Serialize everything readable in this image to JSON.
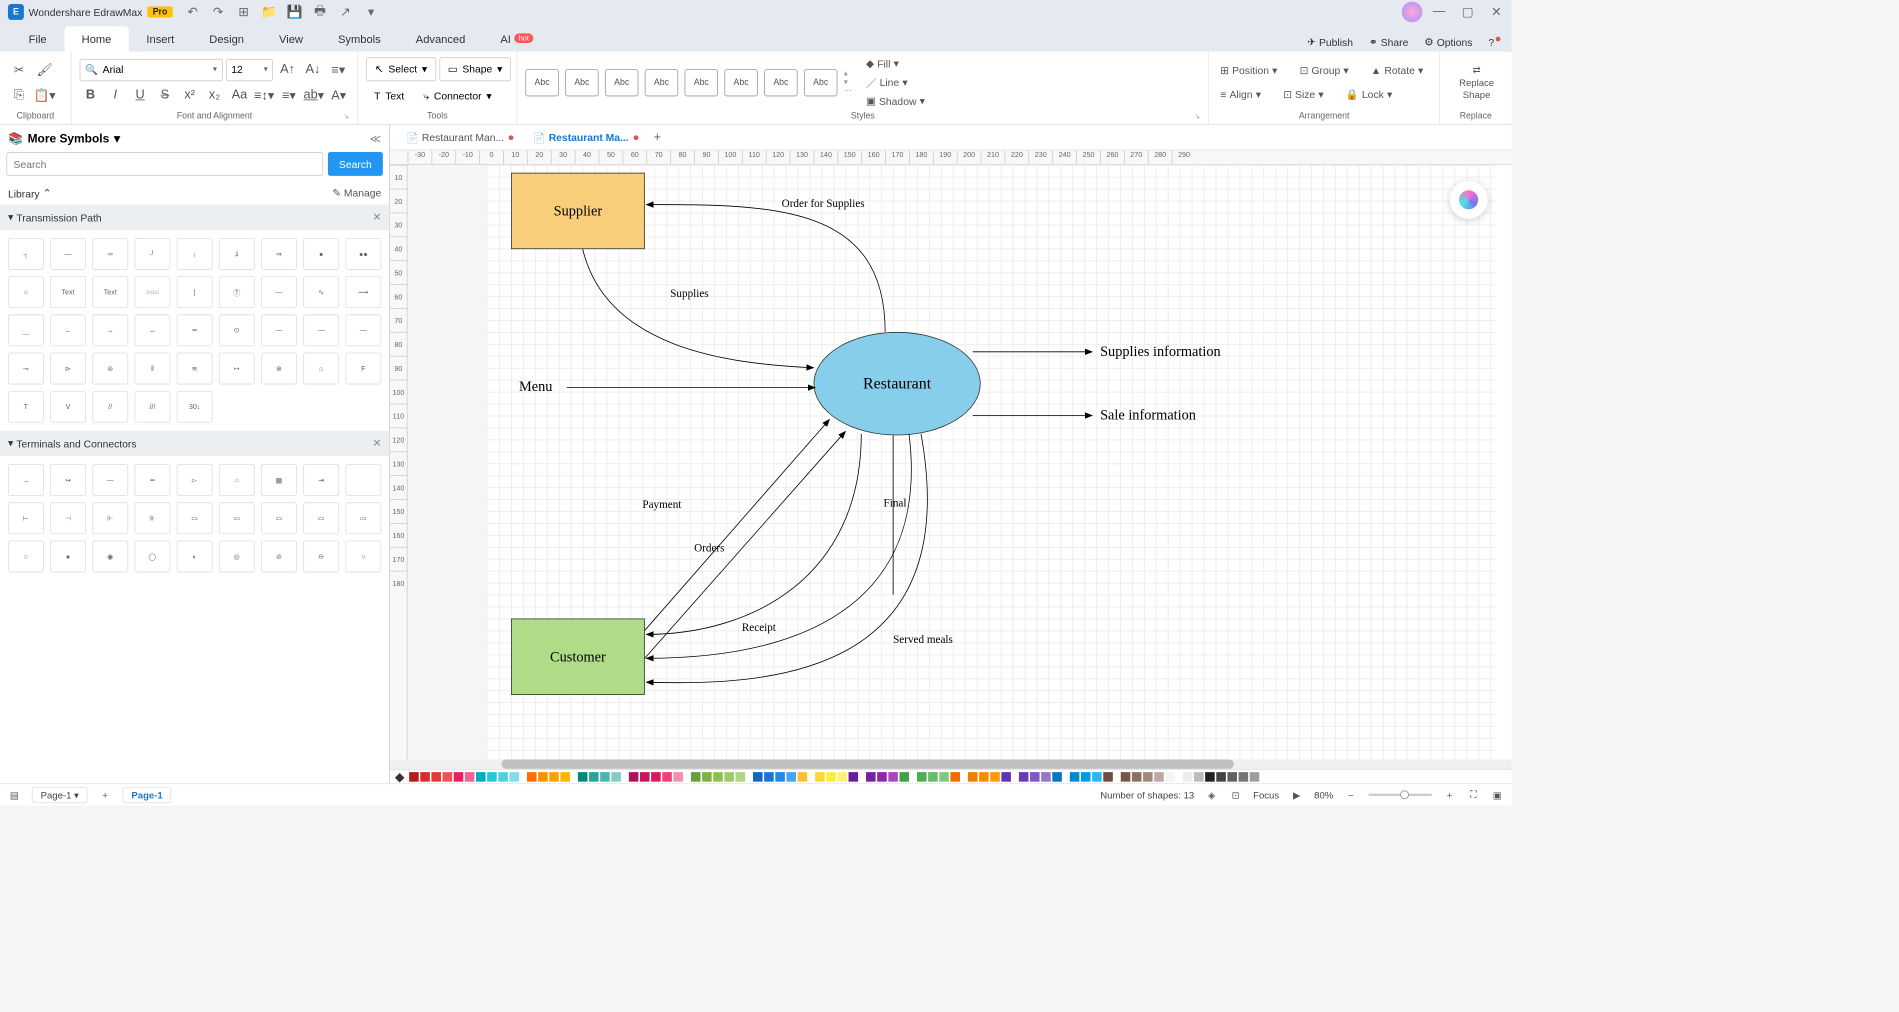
{
  "app": {
    "name": "Wondershare EdrawMax",
    "badge": "Pro"
  },
  "menu": {
    "items": [
      "File",
      "Home",
      "Insert",
      "Design",
      "View",
      "Symbols",
      "Advanced",
      "AI"
    ],
    "ai_hot": "hot",
    "active": "Home"
  },
  "topright": {
    "publish": "Publish",
    "share": "Share",
    "options": "Options"
  },
  "ribbon": {
    "clipboard": "Clipboard",
    "font_align": "Font and Alignment",
    "tools": "Tools",
    "styles": "Styles",
    "arrangement": "Arrangement",
    "replace": "Replace",
    "font": "Arial",
    "size": "12",
    "select": "Select",
    "shape": "Shape",
    "text": "Text",
    "connector": "Connector",
    "fill": "Fill",
    "line": "Line",
    "shadow": "Shadow",
    "position": "Position",
    "align": "Align",
    "group_": "Group",
    "size_": "Size",
    "rotate": "Rotate",
    "lock": "Lock",
    "replace_shape": "Replace\nShape",
    "abc": "Abc"
  },
  "sidepanel": {
    "title": "More Symbols",
    "search_placeholder": "Search",
    "search_btn": "Search",
    "library": "Library",
    "manage": "Manage",
    "cat1": "Transmission Path",
    "cat2": "Terminals and Connectors"
  },
  "doctabs": {
    "t1": "Restaurant Man...",
    "t2": "Restaurant Ma..."
  },
  "diagram": {
    "supplier": "Supplier",
    "customer": "Customer",
    "restaurant": "Restaurant",
    "menu": "Menu",
    "supplies_info": "Supplies information",
    "sale_info": "Sale information",
    "order_supplies": "Order for Supplies",
    "supplies": "Supplies",
    "payment": "Payment",
    "orders": "Orders",
    "final": "Final",
    "receipt": "Receipt",
    "served_meals": "Served meals"
  },
  "ruler_h": [
    "-30",
    "-20",
    "-10",
    "0",
    "10",
    "20",
    "30",
    "40",
    "50",
    "60",
    "70",
    "80",
    "90",
    "100",
    "110",
    "120",
    "130",
    "140",
    "150",
    "160",
    "170",
    "180",
    "190",
    "200",
    "210",
    "220",
    "230",
    "240",
    "250",
    "260",
    "270",
    "280",
    "290"
  ],
  "ruler_v": [
    "10",
    "20",
    "30",
    "40",
    "50",
    "60",
    "70",
    "80",
    "90",
    "100",
    "110",
    "120",
    "130",
    "140",
    "150",
    "160",
    "170",
    "180"
  ],
  "colors": [
    "#b71c1c",
    "#d32f2f",
    "#e53935",
    "#ef5350",
    "#e91e63",
    "#f06292",
    "#00acc1",
    "#26c6da",
    "#4dd0e1",
    "#80deea",
    "#ff6f00",
    "#ff8f00",
    "#ffa000",
    "#ffb300",
    "#00897b",
    "#26a69a",
    "#4db6ac",
    "#80cbc4",
    "#ad1457",
    "#c2185b",
    "#d81b60",
    "#ec407a",
    "#f48fb1",
    "#689f38",
    "#7cb342",
    "#8bc34a",
    "#9ccc65",
    "#aed581",
    "#1565c0",
    "#1976d2",
    "#1e88e5",
    "#42a5f5",
    "#fbc02d",
    "#fdd835",
    "#ffeb3b",
    "#fff176",
    "#6a1b9a",
    "#7b1fa2",
    "#8e24aa",
    "#ab47bc",
    "#43a047",
    "#4caf50",
    "#66bb6a",
    "#81c784",
    "#ef6c00",
    "#f57c00",
    "#fb8c00",
    "#ff9800",
    "#5e35b1",
    "#673ab7",
    "#7e57c2",
    "#9575cd",
    "#0277bd",
    "#0288d1",
    "#039be5",
    "#29b6f6",
    "#6d4c41",
    "#795548",
    "#8d6e63",
    "#a1887f",
    "#bcaaa4",
    "#f5f5f5",
    "#eeeeee",
    "#bdbdbd",
    "#212121",
    "#424242",
    "#616161",
    "#757575",
    "#9e9e9e",
    "#ffffff"
  ],
  "status": {
    "page": "Page-1",
    "page_active": "Page-1",
    "shapes": "Number of shapes: 13",
    "focus": "Focus",
    "zoom": "80%"
  }
}
